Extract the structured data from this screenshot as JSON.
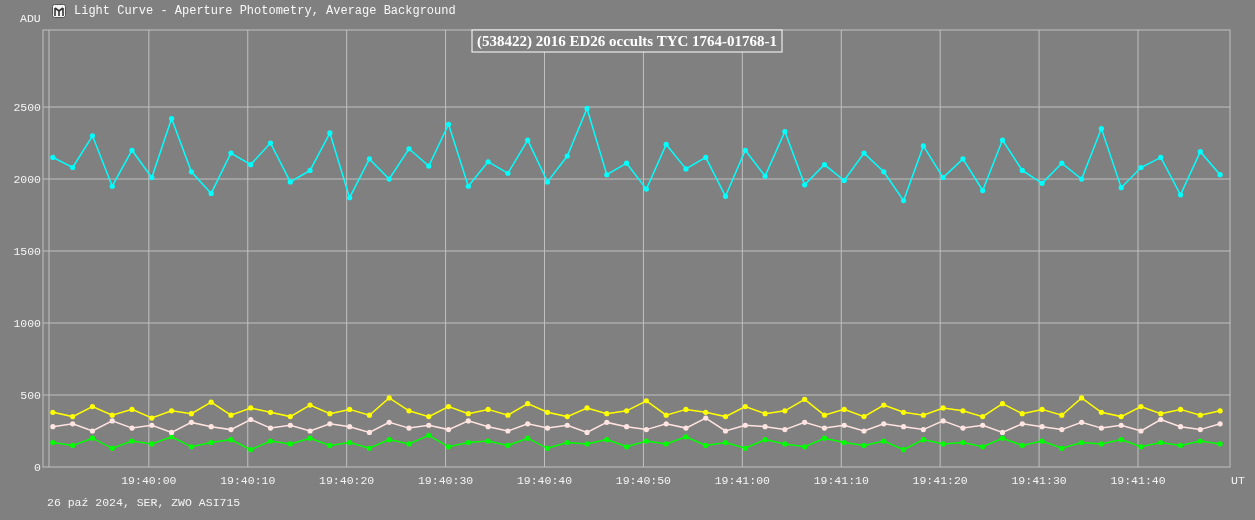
{
  "window": {
    "title": "Light Curve - Aperture Photometry, Average Background"
  },
  "chart": {
    "chart_data": {
      "type": "line",
      "title": "(538422) 2016 ED26 occults TYC 1764-01768-1",
      "xlabel": "UT",
      "ylabel": "ADU",
      "xlim": [
        70789.3,
        70909.3
      ],
      "grid": true,
      "ylim": [
        0,
        3035
      ],
      "xticks": [
        {
          "value": 70800,
          "label": "19:40:00"
        },
        {
          "value": 70810,
          "label": "19:40:10"
        },
        {
          "value": 70820,
          "label": "19:40:20"
        },
        {
          "value": 70830,
          "label": "19:40:30"
        },
        {
          "value": 70840,
          "label": "19:40:40"
        },
        {
          "value": 70850,
          "label": "19:40:50"
        },
        {
          "value": 70860,
          "label": "19:41:00"
        },
        {
          "value": 70870,
          "label": "19:41:10"
        },
        {
          "value": 70880,
          "label": "19:41:20"
        },
        {
          "value": 70890,
          "label": "19:41:30"
        },
        {
          "value": 70900,
          "label": "19:41:40"
        }
      ],
      "yticks": [
        0,
        500,
        1000,
        1500,
        2000,
        2500
      ],
      "x": [
        70790.3,
        70792.3,
        70794.3,
        70796.3,
        70798.3,
        70800.3,
        70802.3,
        70804.3,
        70806.3,
        70808.3,
        70810.3,
        70812.3,
        70814.3,
        70816.3,
        70818.3,
        70820.3,
        70822.3,
        70824.3,
        70826.3,
        70828.3,
        70830.3,
        70832.3,
        70834.3,
        70836.3,
        70838.3,
        70840.3,
        70842.3,
        70844.3,
        70846.3,
        70848.3,
        70850.3,
        70852.3,
        70854.3,
        70856.3,
        70858.3,
        70860.3,
        70862.3,
        70864.3,
        70866.3,
        70868.3,
        70870.3,
        70872.3,
        70874.3,
        70876.3,
        70878.3,
        70880.3,
        70882.3,
        70884.3,
        70886.3,
        70888.3,
        70890.3,
        70892.3,
        70894.3,
        70896.3,
        70898.3,
        70900.3,
        70902.3,
        70904.3,
        70906.3,
        70908.3
      ],
      "series": [
        {
          "color": "#00ffff",
          "values": [
            2150,
            2080,
            2300,
            1950,
            2200,
            2010,
            2420,
            2050,
            1900,
            2180,
            2100,
            2250,
            1980,
            2060,
            2320,
            1870,
            2140,
            2000,
            2210,
            2090,
            2380,
            1950,
            2120,
            2040,
            2270,
            1980,
            2160,
            2490,
            2030,
            2110,
            1930,
            2240,
            2070,
            2150,
            1880,
            2200,
            2020,
            2330,
            1960,
            2100,
            1990,
            2180,
            2050,
            1850,
            2230,
            2010,
            2140,
            1920,
            2270,
            2060,
            1970,
            2110,
            2000,
            2350,
            1940,
            2080,
            2150,
            1890,
            2190,
            2030
          ]
        },
        {
          "color": "#00ff00",
          "values": [
            170,
            150,
            200,
            130,
            180,
            160,
            210,
            140,
            170,
            190,
            120,
            180,
            160,
            200,
            150,
            170,
            130,
            190,
            160,
            220,
            140,
            170,
            180,
            150,
            200,
            130,
            170,
            160,
            190,
            140,
            180,
            160,
            210,
            150,
            170,
            130,
            190,
            160,
            140,
            200,
            170,
            150,
            180,
            120,
            190,
            160,
            170,
            140,
            200,
            150,
            180,
            130,
            170,
            160,
            190,
            140,
            170,
            150,
            180,
            160
          ]
        },
        {
          "color": "#ffff00",
          "values": [
            380,
            350,
            420,
            360,
            400,
            340,
            390,
            370,
            450,
            360,
            410,
            380,
            350,
            430,
            370,
            400,
            360,
            480,
            390,
            350,
            420,
            370,
            400,
            360,
            440,
            380,
            350,
            410,
            370,
            390,
            460,
            360,
            400,
            380,
            350,
            420,
            370,
            390,
            470,
            360,
            400,
            350,
            430,
            380,
            360,
            410,
            390,
            350,
            440,
            370,
            400,
            360,
            480,
            380,
            350,
            420,
            370,
            400,
            360,
            390
          ]
        },
        {
          "color": "#ffe4e1",
          "values": [
            280,
            300,
            250,
            320,
            270,
            290,
            240,
            310,
            280,
            260,
            330,
            270,
            290,
            250,
            300,
            280,
            240,
            310,
            270,
            290,
            260,
            320,
            280,
            250,
            300,
            270,
            290,
            240,
            310,
            280,
            260,
            300,
            270,
            340,
            250,
            290,
            280,
            260,
            310,
            270,
            290,
            250,
            300,
            280,
            260,
            320,
            270,
            290,
            240,
            300,
            280,
            260,
            310,
            270,
            290,
            250,
            330,
            280,
            260,
            300
          ]
        }
      ]
    }
  },
  "footer": "26 paź 2024, SER, ZWO ASI715"
}
